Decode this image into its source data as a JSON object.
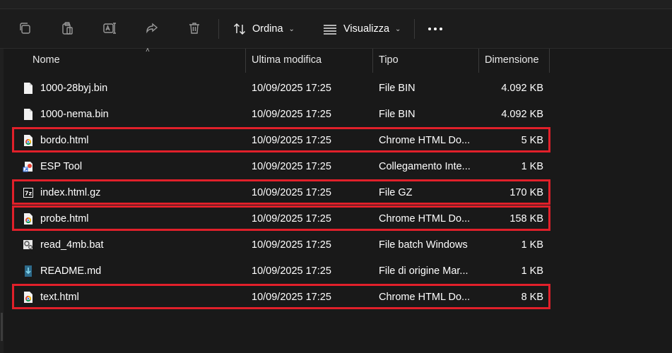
{
  "toolbar": {
    "sort_label": "Ordina",
    "view_label": "Visualizza",
    "icons": [
      "copy-icon",
      "paste-icon",
      "rename-icon",
      "share-icon",
      "delete-icon",
      "sort-icon",
      "view-icon",
      "more-icon"
    ]
  },
  "columns": {
    "name": "Nome",
    "modified": "Ultima modifica",
    "type": "Tipo",
    "size": "Dimensione"
  },
  "files": [
    {
      "name": "1000-28byj.bin",
      "modified": "10/09/2025 17:25",
      "type": "File BIN",
      "size": "4.092 KB",
      "icon": "file-icon",
      "highlighted": false
    },
    {
      "name": "1000-nema.bin",
      "modified": "10/09/2025 17:25",
      "type": "File BIN",
      "size": "4.092 KB",
      "icon": "file-icon",
      "highlighted": false
    },
    {
      "name": "bordo.html",
      "modified": "10/09/2025 17:25",
      "type": "Chrome HTML Do...",
      "size": "5 KB",
      "icon": "chrome-icon",
      "highlighted": true
    },
    {
      "name": "ESP Tool",
      "modified": "10/09/2025 17:25",
      "type": "Collegamento Inte...",
      "size": "1 KB",
      "icon": "shortcut-icon",
      "highlighted": false
    },
    {
      "name": "index.html.gz",
      "modified": "10/09/2025 17:25",
      "type": "File GZ",
      "size": "170 KB",
      "icon": "7zip-icon",
      "highlighted": true
    },
    {
      "name": "probe.html",
      "modified": "10/09/2025 17:25",
      "type": "Chrome HTML Do...",
      "size": "158 KB",
      "icon": "chrome-icon",
      "highlighted": true
    },
    {
      "name": "read_4mb.bat",
      "modified": "10/09/2025 17:25",
      "type": "File batch Windows",
      "size": "1 KB",
      "icon": "batch-icon",
      "highlighted": false
    },
    {
      "name": "README.md",
      "modified": "10/09/2025 17:25",
      "type": "File di origine Mar...",
      "size": "1 KB",
      "icon": "markdown-icon",
      "highlighted": false
    },
    {
      "name": "text.html",
      "modified": "10/09/2025 17:25",
      "type": "Chrome HTML Do...",
      "size": "8 KB",
      "icon": "chrome-icon",
      "highlighted": true
    }
  ],
  "colors": {
    "highlight": "#e1202a",
    "background": "#191919"
  }
}
